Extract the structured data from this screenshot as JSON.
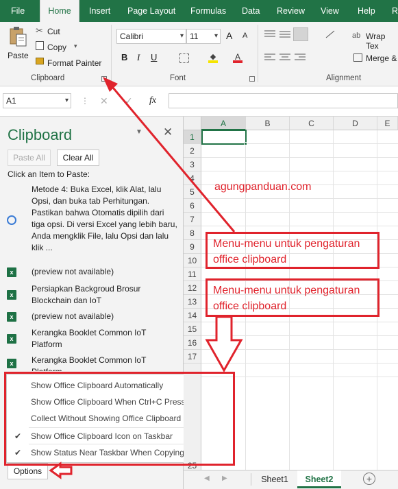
{
  "menu_tabs": [
    "File",
    "Home",
    "Insert",
    "Page Layout",
    "Formulas",
    "Data",
    "Review",
    "View",
    "Help",
    "R"
  ],
  "ribbon": {
    "clipboard": {
      "paste": "Paste",
      "cut": "Cut",
      "copy": "Copy",
      "copy_arrow": "▾",
      "format_painter": "Format Painter",
      "label": "Clipboard"
    },
    "font": {
      "name": "Calibri",
      "size": "11",
      "grow": "A",
      "shrink": "A",
      "bold": "B",
      "italic": "I",
      "underline": "U",
      "label": "Font"
    },
    "alignment": {
      "wrap": "Wrap Tex",
      "merge": "Merge &",
      "label": "Alignment"
    }
  },
  "formula_bar": {
    "name_box": "A1",
    "fx": "fx",
    "cancel": "✕",
    "confirm": "✓",
    "value": ""
  },
  "clipboard_pane": {
    "title": "Clipboard",
    "paste_all": "Paste All",
    "clear_all": "Clear All",
    "instruction": "Click an Item to Paste:",
    "items": [
      "Metode 4: Buka Excel, klik Alat, lalu Opsi, dan buka tab Perhitungan. Pastikan bahwa Otomatis dipilih dari tiga opsi. Di versi Excel yang lebih baru, Anda mengklik File, lalu Opsi dan lalu klik ...",
      "(preview not available)",
      "Persiapkan Backgroud Brosur Blockchain dan IoT",
      "(preview not available)",
      "Kerangka Booklet Common IoT Platform",
      "Kerangka Booklet Common IoT Platform"
    ],
    "options_button": "Options",
    "options_menu": [
      {
        "label": "Show Office Clipboard Automatically",
        "checked": false
      },
      {
        "label": "Show Office Clipboard When Ctrl+C Pressed Twice",
        "checked": false
      },
      {
        "label": "Collect Without Showing Office Clipboard",
        "checked": false
      },
      {
        "label": "Show Office Clipboard Icon on Taskbar",
        "checked": true
      },
      {
        "label": "Show Status Near Taskbar When Copying",
        "checked": true
      }
    ],
    "check_mark": "✔"
  },
  "grid": {
    "columns": [
      "A",
      "B",
      "C",
      "D",
      "E"
    ],
    "rows": [
      "1",
      "2",
      "3",
      "4",
      "5",
      "6",
      "7",
      "8",
      "9",
      "10",
      "11",
      "12",
      "13",
      "14",
      "15",
      "16",
      "17",
      "25"
    ],
    "selected_cell": "A1"
  },
  "sheets": [
    "Sheet1",
    "Sheet2"
  ],
  "active_sheet": "Sheet2",
  "annotations": {
    "watermark": "agungpanduan.com",
    "box1": "Menu-menu untuk pengaturan office clipboard",
    "box2": "Menu-menu untuk pengaturan  office clipboard"
  },
  "colors": {
    "excel_green": "#217346",
    "annotation_red": "#e0232c"
  }
}
